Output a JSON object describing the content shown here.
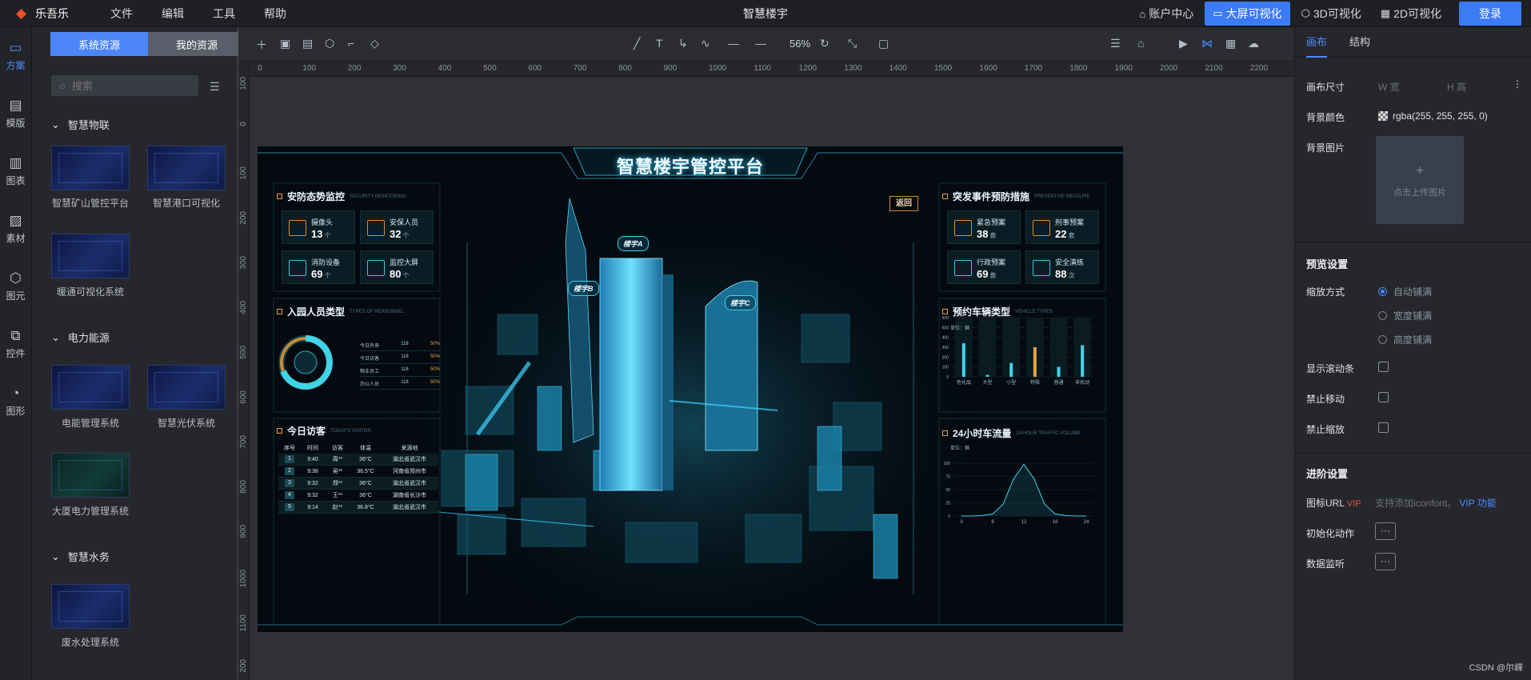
{
  "app": {
    "logo_text": "乐吾乐",
    "title": "智慧楼宇",
    "menu": [
      "文件",
      "编辑",
      "工具",
      "帮助"
    ],
    "top_actions": [
      {
        "label": "账户中心",
        "icon": "home-icon"
      },
      {
        "label": "大屏可视化",
        "icon": "monitor-icon",
        "active": true
      },
      {
        "label": "3D可视化",
        "icon": "cube-icon"
      },
      {
        "label": "2D可视化",
        "icon": "grid-icon"
      }
    ],
    "login_label": "登录",
    "accent": "#3c7bf6"
  },
  "rail": [
    {
      "label": "方案",
      "icon": "monitor-icon",
      "active": true
    },
    {
      "label": "模版",
      "icon": "document-icon"
    },
    {
      "label": "图表",
      "icon": "chart-icon"
    },
    {
      "label": "素材",
      "icon": "image-icon"
    },
    {
      "label": "图元",
      "icon": "cube-icon"
    },
    {
      "label": "控件",
      "icon": "component-icon"
    },
    {
      "label": "图形",
      "icon": "shapes-icon"
    }
  ],
  "resources": {
    "tabs": [
      "系统资源",
      "我的资源"
    ],
    "search_placeholder": "搜索",
    "categories": [
      {
        "name": "智慧物联",
        "items": [
          "智慧矿山管控平台",
          "智慧港口可视化",
          "暖通可视化系统"
        ]
      },
      {
        "name": "电力能源",
        "items": [
          "电能管理系统",
          "智慧光伏系统",
          "大厦电力管理系统"
        ]
      },
      {
        "name": "智慧水务",
        "items": [
          "废水处理系统"
        ]
      }
    ]
  },
  "toolbar": {
    "zoom": "56%",
    "ruler_h": [
      "0",
      "100",
      "200",
      "300",
      "400",
      "500",
      "600",
      "700",
      "800",
      "900",
      "1000",
      "1100",
      "1200",
      "1300",
      "1400",
      "1500",
      "1600",
      "1700",
      "1800",
      "1900",
      "2000",
      "2100",
      "2200"
    ],
    "ruler_v": [
      "100",
      "0",
      "100",
      "200",
      "300",
      "400",
      "500",
      "600",
      "700",
      "800",
      "900",
      "1000",
      "1100",
      "200"
    ]
  },
  "dashboard": {
    "title": "智慧楼宇管控平台",
    "back_label": "返回",
    "security": {
      "title": "安防态势监控",
      "subtitle": "SECURITY MONITORING",
      "kpis": [
        {
          "label": "摄像头",
          "value": "13",
          "unit": "个"
        },
        {
          "label": "安保人员",
          "value": "32",
          "unit": "个"
        },
        {
          "label": "消防设备",
          "value": "69",
          "unit": "个"
        },
        {
          "label": "监控大屏",
          "value": "80",
          "unit": "个"
        }
      ]
    },
    "personnel": {
      "title": "入园人员类型",
      "subtitle": "TYPES OF PERSONNEL",
      "rows": [
        {
          "label": "今日外来",
          "count": "118",
          "pct": "50%"
        },
        {
          "label": "今日访客",
          "count": "118",
          "pct": "50%"
        },
        {
          "label": "物业员工",
          "count": "118",
          "pct": "50%"
        },
        {
          "label": "办公人员",
          "count": "118",
          "pct": "50%"
        }
      ]
    },
    "visitors": {
      "title": "今日访客",
      "subtitle": "TODAY'S VISITOR",
      "headers": [
        "序号",
        "时间",
        "访客",
        "体温",
        "来源地"
      ],
      "rows": [
        [
          "1",
          "9:40",
          "周**",
          "36°C",
          "湖北省武汉市"
        ],
        [
          "2",
          "9:38",
          "吴**",
          "36.5°C",
          "河南省郑州市"
        ],
        [
          "3",
          "9:32",
          "郑**",
          "36°C",
          "湖北省武汉市"
        ],
        [
          "4",
          "9:32",
          "王**",
          "36°C",
          "湖南省长沙市"
        ],
        [
          "5",
          "9:14",
          "赵**",
          "36.8°C",
          "湖北省武汉市"
        ]
      ]
    },
    "emergency": {
      "title": "突发事件预防措施",
      "subtitle": "PREVENTIVE MEASURE",
      "kpis": [
        {
          "label": "紧急预案",
          "value": "38",
          "unit": "套"
        },
        {
          "label": "刑事预案",
          "value": "22",
          "unit": "套"
        },
        {
          "label": "行政预案",
          "value": "69",
          "unit": "套"
        },
        {
          "label": "安全演练",
          "value": "88",
          "unit": "次"
        }
      ]
    },
    "buildings": [
      "楼宇A",
      "楼宇B",
      "楼宇C"
    ],
    "vehicles": {
      "title": "预约车辆类型",
      "subtitle": "VEHICLE TYPES",
      "unit": "单位：辆"
    },
    "traffic": {
      "title": "24小时车流量",
      "subtitle": "24-HOUR TRAFFIC VOLUME",
      "unit": "单位：辆"
    }
  },
  "chart_data": [
    {
      "type": "bar",
      "categories": [
        "危化品",
        "大型",
        "小型",
        "特殊",
        "普通",
        "非机动"
      ],
      "values": [
        340,
        20,
        140,
        300,
        100,
        320
      ],
      "ylim": [
        0,
        600
      ],
      "yticks": [
        "0",
        "100",
        "200",
        "300",
        "400",
        "500",
        "600"
      ],
      "ylabel": "单位：辆",
      "colors": [
        "#3fd4e6",
        "#3fd4e6",
        "#3fd4e6",
        "#f0a23a",
        "#3fd4e6",
        "#3fd4e6"
      ]
    },
    {
      "type": "area",
      "x": [
        0,
        2,
        4,
        6,
        8,
        10,
        12,
        14,
        16,
        18,
        20,
        22,
        24
      ],
      "values": [
        0,
        0,
        1,
        4,
        22,
        70,
        98,
        70,
        22,
        4,
        1,
        0,
        0
      ],
      "xticks": [
        "0",
        "6",
        "12",
        "18",
        "24"
      ],
      "yticks": [
        "0",
        "25",
        "50",
        "75",
        "100"
      ],
      "ylim": [
        0,
        100
      ],
      "ylabel": "单位：辆",
      "color": "#3fd4e6"
    }
  ],
  "right_panel": {
    "tabs": [
      "画布",
      "结构"
    ],
    "canvas_size_label": "画布尺寸",
    "width_ph": "W 宽",
    "height_ph": "H 高",
    "bg_color_label": "背景颜色",
    "bg_color_value": "rgba(255, 255, 255, 0)",
    "bg_image_label": "背景图片",
    "upload_label": "点击上传图片",
    "preview_title": "预览设置",
    "scale_label": "缩放方式",
    "scale_options": [
      "自动铺满",
      "宽度铺满",
      "高度铺满"
    ],
    "scale_selected": 0,
    "scrollbar_label": "显示滚动条",
    "no_move_label": "禁止移动",
    "no_zoom_label": "禁止缩放",
    "advanced_title": "进阶设置",
    "icon_url_label": "图标URL",
    "vip_badge": "VIP",
    "icon_url_hint": "支持添加iconfont。",
    "vip_feature": "VIP 功能",
    "init_label": "初始化动作",
    "listen_label": "数据监听"
  },
  "watermark": "CSDN @尔嵘"
}
